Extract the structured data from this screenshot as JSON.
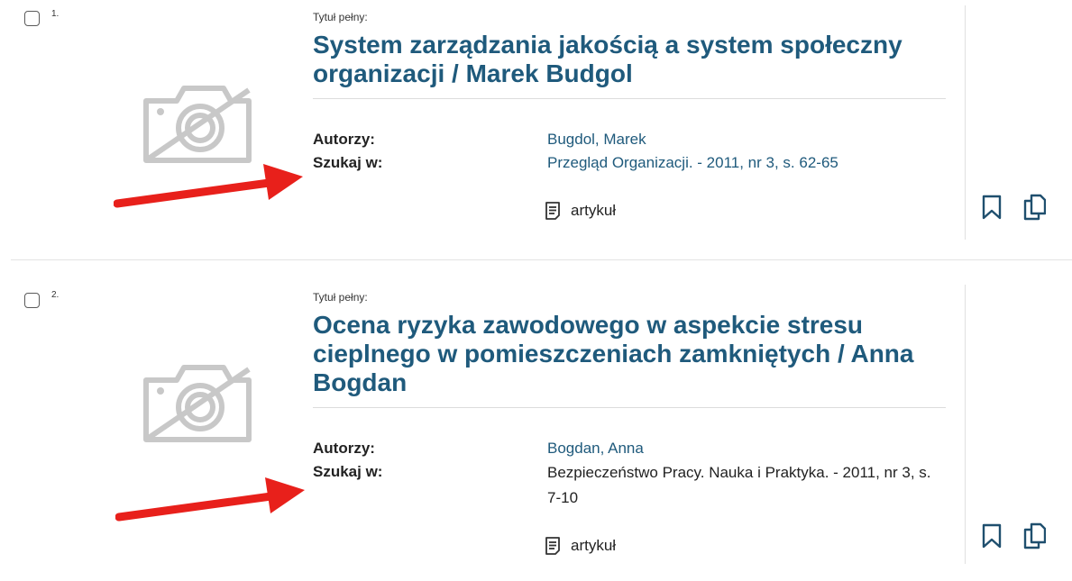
{
  "results": [
    {
      "number": "1.",
      "title_label": "Tytuł pełny:",
      "title": "System zarządzania jakością a system społeczny organizacji / Marek Budgol",
      "authors_label": "Autorzy:",
      "authors_value": "Bugdol, Marek",
      "search_label": "Szukaj w:",
      "search_value": "Przegląd Organizacji. - 2011, nr 3, s. 62-65",
      "type_label": "artykuł"
    },
    {
      "number": "2.",
      "title_label": "Tytuł pełny:",
      "title": "Ocena ryzyka zawodowego w aspekcie stresu cieplnego w pomieszczeniach zamkniętych / Anna Bogdan",
      "authors_label": "Autorzy:",
      "authors_value": "Bogdan, Anna",
      "search_label": "Szukaj w:",
      "search_value": "Bezpieczeństwo Pracy. Nauka i Praktyka. - 2011, nr 3, s. 7-10",
      "type_label": "artykuł"
    }
  ],
  "colors": {
    "link": "#1f5a7c",
    "annotation_arrow": "#e8201b",
    "placeholder_icon": "#c8c8c8"
  },
  "icons": {
    "thumbnail": "no-image-camera-icon",
    "type": "document-icon",
    "bookmark": "bookmark-icon",
    "copy": "copy-icon",
    "annotation": "red-arrow-icon"
  }
}
